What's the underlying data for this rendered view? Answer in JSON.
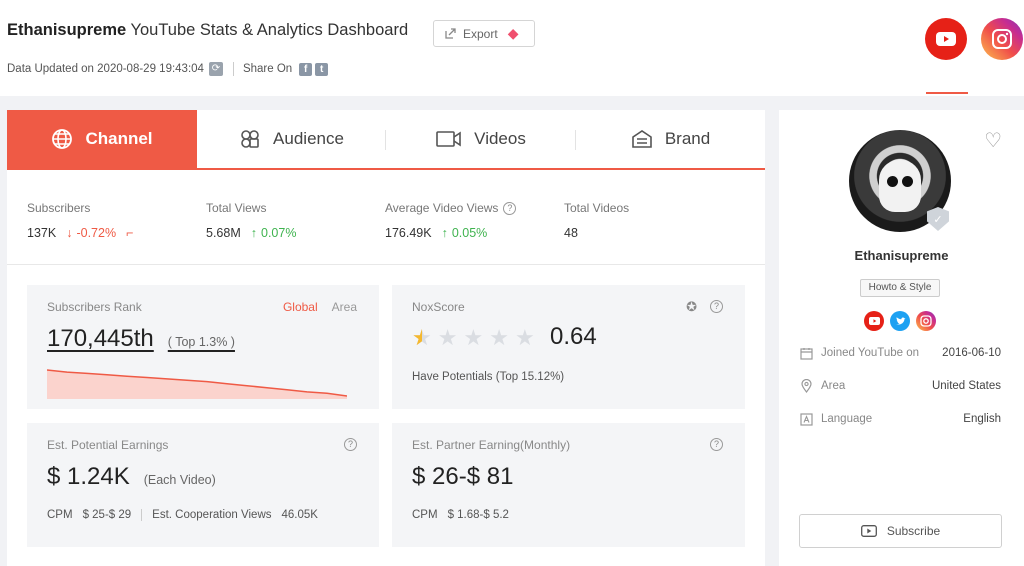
{
  "header": {
    "channel_name": "Ethanisupreme",
    "title_suffix": "YouTube Stats & Analytics Dashboard",
    "export_label": "Export",
    "data_updated": "Data Updated on 2020-08-29 19:43:04",
    "share_label": "Share On"
  },
  "tabs": [
    {
      "label": "Channel",
      "icon": "globe-icon"
    },
    {
      "label": "Audience",
      "icon": "audience-icon"
    },
    {
      "label": "Videos",
      "icon": "video-camera-icon"
    },
    {
      "label": "Brand",
      "icon": "brand-icon"
    }
  ],
  "stats": {
    "subscribers": {
      "label": "Subscribers",
      "value": "137K",
      "change": "-0.72%"
    },
    "total_views": {
      "label": "Total Views",
      "value": "5.68M",
      "change": "0.07%"
    },
    "avg_video_views": {
      "label": "Average Video Views",
      "value": "176.49K",
      "change": "0.05%"
    },
    "total_videos": {
      "label": "Total Videos",
      "value": "48"
    }
  },
  "rank_card": {
    "label": "Subscribers Rank",
    "toggle_global": "Global",
    "toggle_area": "Area",
    "value": "170,445th",
    "note": "( Top 1.3% )",
    "sparkline": [
      100,
      97,
      95,
      93,
      91,
      89,
      87,
      85,
      83,
      80,
      77,
      74,
      71,
      68,
      66,
      62
    ]
  },
  "nox_card": {
    "label": "NoxScore",
    "score": "0.64",
    "rating_out_of_5": 0.5,
    "potential_text": "Have Potentials (Top 15.12%)"
  },
  "earnings_card": {
    "label": "Est. Potential Earnings",
    "value": "$ 1.24K",
    "unit": "(Each Video)",
    "cpm_label": "CPM",
    "cpm_value": "$ 25-$ 29",
    "coop_label": "Est. Cooperation Views",
    "coop_value": "46.05K"
  },
  "partner_card": {
    "label": "Est. Partner Earning(Monthly)",
    "value": "$ 26-$ 81",
    "cpm_label": "CPM",
    "cpm_value": "$ 1.68-$ 5.2"
  },
  "profile": {
    "name": "Ethanisupreme",
    "category": "Howto & Style",
    "joined_label": "Joined YouTube on",
    "joined_value": "2016-06-10",
    "area_label": "Area",
    "area_value": "United States",
    "language_label": "Language",
    "language_value": "English",
    "subscribe_label": "Subscribe"
  },
  "colors": {
    "accent": "#ef5a45",
    "up": "#3fb34f",
    "youtube": "#e62117",
    "twitter": "#1da1f2"
  }
}
